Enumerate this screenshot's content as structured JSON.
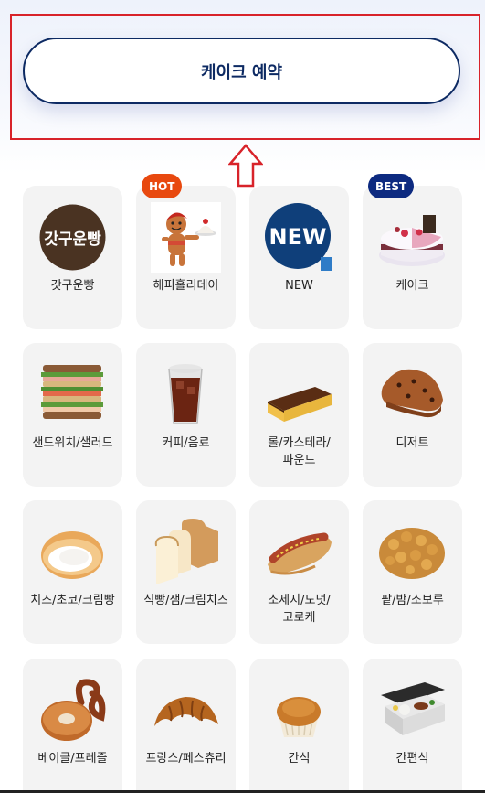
{
  "reservation": {
    "button_label": "케이크 예약"
  },
  "categories": [
    {
      "label": "갓구운빵",
      "icon": "gatguun-bread-logo-icon",
      "logo_text": "갓구운빵"
    },
    {
      "label": "해피홀리데이",
      "icon": "gingerbread-man-icon",
      "badge": "HOT",
      "badge_color": "#e8490f"
    },
    {
      "label": "NEW",
      "icon": "new-logo-icon",
      "logo_text": "NEW"
    },
    {
      "label": "케이크",
      "icon": "cake-icon",
      "badge": "BEST",
      "badge_color": "#0d2a80"
    },
    {
      "label": "샌드위치/샐러드",
      "icon": "sandwich-icon"
    },
    {
      "label": "커피/음료",
      "icon": "iced-coffee-icon"
    },
    {
      "label": "롤/카스테라/\n파운드",
      "icon": "castella-icon"
    },
    {
      "label": "디저트",
      "icon": "scone-icon"
    },
    {
      "label": "치즈/초코/크림빵",
      "icon": "cream-bun-icon"
    },
    {
      "label": "식빵/잼/크림치즈",
      "icon": "white-bread-icon"
    },
    {
      "label": "소세지/도넛/\n고로케",
      "icon": "sausage-bread-icon"
    },
    {
      "label": "팥/밤/소보루",
      "icon": "soboro-bread-icon"
    },
    {
      "label": "베이글/프레즐",
      "icon": "bagel-pretzel-icon"
    },
    {
      "label": "프랑스/페스츄리",
      "icon": "croissant-icon"
    },
    {
      "label": "간식",
      "icon": "muffin-icon"
    },
    {
      "label": "간편식",
      "icon": "lunchbox-icon"
    }
  ]
}
